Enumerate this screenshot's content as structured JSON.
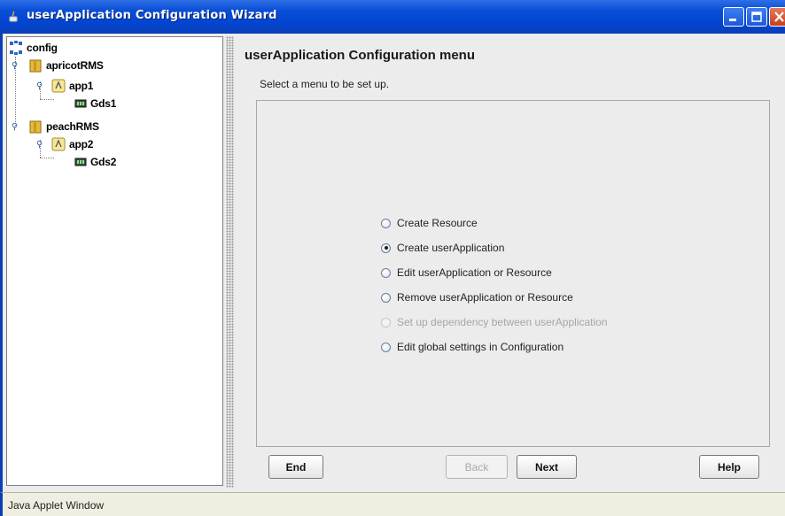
{
  "window": {
    "title": "userApplication Configuration Wizard",
    "controls": [
      "minimize-icon",
      "maximize-icon",
      "close-icon"
    ]
  },
  "tree": {
    "root": {
      "label": "config",
      "icon": "config-icon"
    },
    "nodes": [
      {
        "label": "apricotRMS",
        "icon": "folder-icon",
        "expanded": true
      },
      {
        "label": "app1",
        "icon": "application-icon",
        "expanded": true
      },
      {
        "label": "Gds1",
        "icon": "disk-resource-icon"
      },
      {
        "label": "peachRMS",
        "icon": "folder-icon",
        "expanded": true
      },
      {
        "label": "app2",
        "icon": "application-icon",
        "expanded": true
      },
      {
        "label": "Gds2",
        "icon": "disk-resource-icon"
      }
    ]
  },
  "main": {
    "heading": "userApplication Configuration menu",
    "subtitle": "Select a menu to be set up.",
    "options": [
      {
        "label": "Create Resource",
        "checked": false,
        "enabled": true
      },
      {
        "label": "Create userApplication",
        "checked": true,
        "enabled": true
      },
      {
        "label": "Edit userApplication or Resource",
        "checked": false,
        "enabled": true
      },
      {
        "label": "Remove userApplication or Resource",
        "checked": false,
        "enabled": true
      },
      {
        "label": "Set up dependency between userApplication",
        "checked": false,
        "enabled": false
      },
      {
        "label": "Edit global settings in Configuration",
        "checked": false,
        "enabled": true
      }
    ]
  },
  "buttons": {
    "end": "End",
    "back": "Back",
    "next": "Next",
    "help": "Help"
  },
  "status": {
    "text": "Java Applet Window"
  },
  "colors": {
    "titlebar": "#0a4fd8",
    "panel": "#ececec",
    "disabled_text": "#a6a6a6"
  }
}
